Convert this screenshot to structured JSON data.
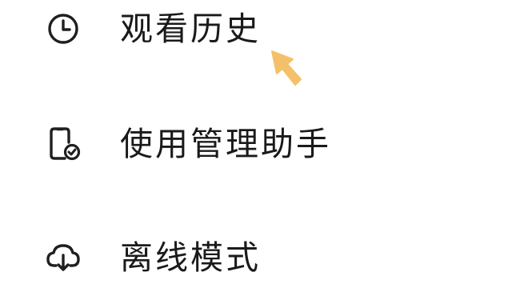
{
  "menu": {
    "items": [
      {
        "label": "观看历史",
        "icon": "clock-icon"
      },
      {
        "label": "使用管理助手",
        "icon": "phone-check-icon"
      },
      {
        "label": "离线模式",
        "icon": "cloud-download-icon"
      }
    ]
  },
  "colors": {
    "text": "#1a1a1a",
    "icon": "#1f1f1f",
    "pointer": "#f5c06a"
  }
}
